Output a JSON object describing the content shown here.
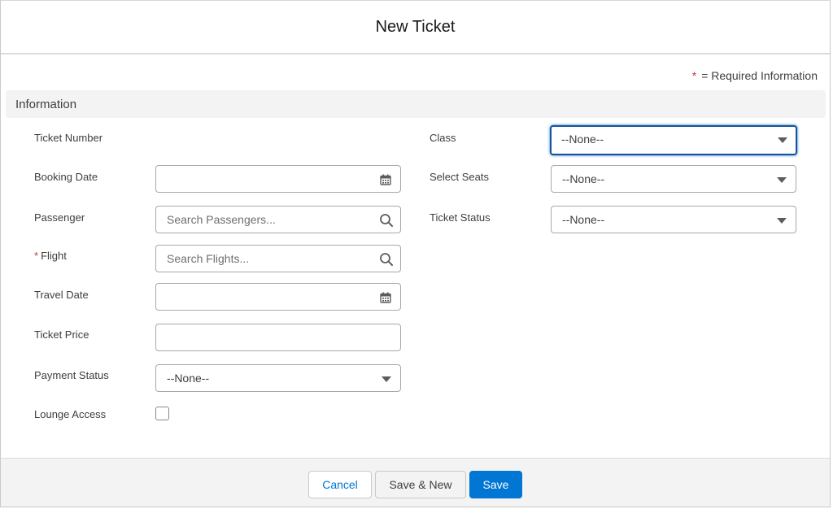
{
  "modal": {
    "title": "New Ticket",
    "required_note": {
      "star": "*",
      "text": "= Required Information"
    },
    "section": {
      "title": "Information"
    }
  },
  "left_fields": {
    "ticket_number": {
      "label": "Ticket Number"
    },
    "booking_date": {
      "label": "Booking Date",
      "icon": "calendar-icon"
    },
    "passenger": {
      "label": "Passenger",
      "placeholder": "Search Passengers...",
      "icon": "search-icon"
    },
    "flight": {
      "required_star": "*",
      "label": "Flight",
      "placeholder": "Search Flights...",
      "icon": "search-icon"
    },
    "travel_date": {
      "label": "Travel Date",
      "icon": "calendar-icon"
    },
    "ticket_price": {
      "label": "Ticket Price"
    },
    "payment_status": {
      "label": "Payment Status",
      "value": "--None--"
    },
    "lounge_access": {
      "label": "Lounge Access",
      "checked": false
    }
  },
  "right_fields": {
    "class": {
      "label": "Class",
      "value": "--None--"
    },
    "select_seats": {
      "label": "Select Seats",
      "value": "--None--"
    },
    "ticket_status": {
      "label": "Ticket Status",
      "value": "--None--"
    }
  },
  "footer": {
    "cancel_label": "Cancel",
    "save_new_label": "Save & New",
    "save_label": "Save"
  },
  "colors": {
    "brand": "#0176d3",
    "required": "#c23934",
    "focus_border": "#1b5297"
  }
}
